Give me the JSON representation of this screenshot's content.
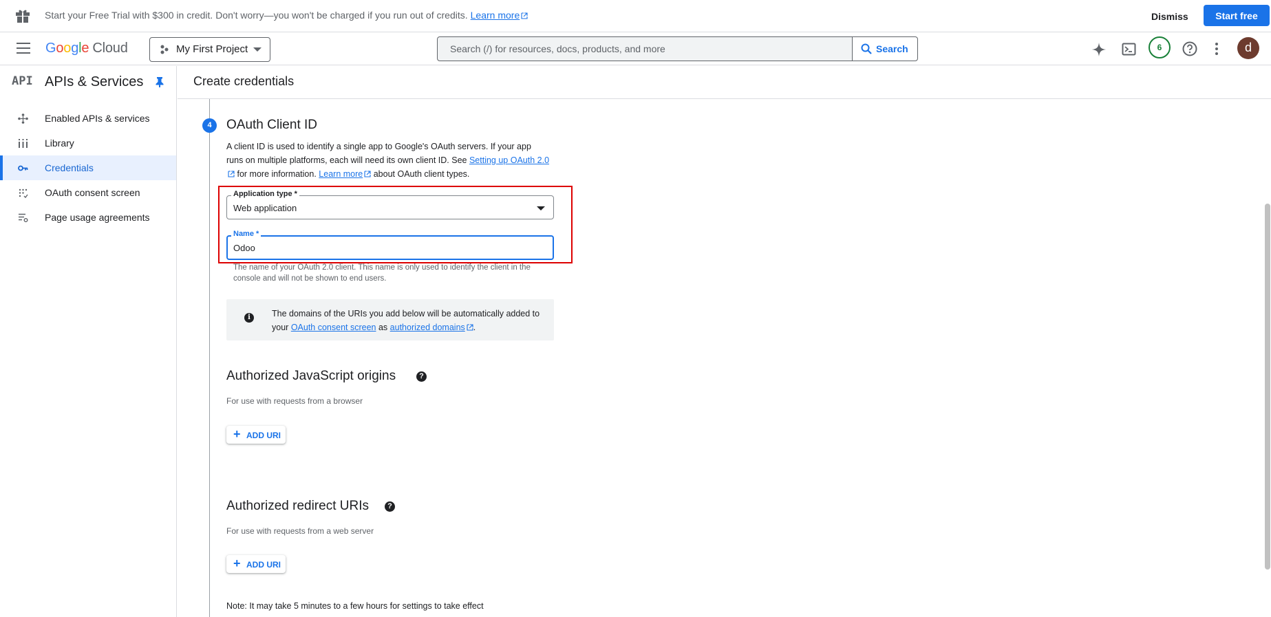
{
  "promo": {
    "text": "Start your Free Trial with $300 in credit. Don't worry—you won't be charged if you run out of credits.",
    "learn_more": "Learn more",
    "dismiss": "Dismiss",
    "start_free": "Start free"
  },
  "header": {
    "logo_google": [
      "G",
      "o",
      "o",
      "g",
      "l",
      "e"
    ],
    "logo_cloud": "Cloud",
    "project": "My First Project",
    "search_placeholder": "Search (/) for resources, docs, products, and more",
    "search_button": "Search",
    "notification_count": "6",
    "avatar_letter": "d",
    "brand_color": "#1a73e8"
  },
  "sidebar": {
    "api_glyph": "API",
    "title": "APIs & Services",
    "items": [
      {
        "label": "Enabled APIs & services",
        "icon": "diamond-dots-icon"
      },
      {
        "label": "Library",
        "icon": "library-icon"
      },
      {
        "label": "Credentials",
        "icon": "key-icon",
        "active": true
      },
      {
        "label": "OAuth consent screen",
        "icon": "consent-icon"
      },
      {
        "label": "Page usage agreements",
        "icon": "settings-list-icon"
      }
    ]
  },
  "main": {
    "title": "Create credentials",
    "step_number": "4",
    "step_title": "OAuth Client ID",
    "desc_part1": "A client ID is used to identify a single app to Google's OAuth servers. If your app runs on multiple platforms, each will need its own client ID. See",
    "desc_link1": "Setting up OAuth 2.0",
    "desc_part2": "for more information.",
    "desc_link2": "Learn more",
    "desc_part3": "about OAuth client types.",
    "app_type_label": "Application type *",
    "app_type_value": "Web application",
    "name_label": "Name *",
    "name_value": "Odoo",
    "name_hint": "The name of your OAuth 2.0 client. This name is only used to identify the client in the console and will not be shown to end users.",
    "info_part1": "The domains of the URIs you add below will be automatically added to your",
    "info_link1": "OAuth consent screen",
    "info_part2": "as",
    "info_link2": "authorized domains",
    "info_end": ".",
    "js_origins_title": "Authorized JavaScript origins",
    "js_origins_sub": "For use with requests from a browser",
    "add_uri": "ADD URI",
    "redirect_title": "Authorized redirect URIs",
    "redirect_sub": "For use with requests from a web server",
    "note": "Note: It may take 5 minutes to a few hours for settings to take effect"
  }
}
